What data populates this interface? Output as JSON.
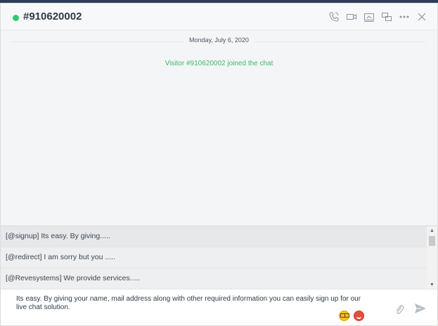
{
  "header": {
    "title": "#910620002",
    "icons": [
      "phone-icon",
      "video-icon",
      "screen-share-icon",
      "co-browse-icon",
      "more-icon",
      "close-icon"
    ],
    "status_color": "#2ecc71"
  },
  "messages": {
    "date": "Monday, July 6, 2020",
    "system": "Visitor #910620002 joined the chat"
  },
  "canned": {
    "items": [
      "[@signup] Its easy. By giving.....",
      "[@redirect] I am sorry but you .....",
      "[@Revesystems] We provide services....."
    ]
  },
  "composer": {
    "text": "Its easy. By giving your name, mail address along with other required information you can easily sign up for our live chat solution."
  }
}
